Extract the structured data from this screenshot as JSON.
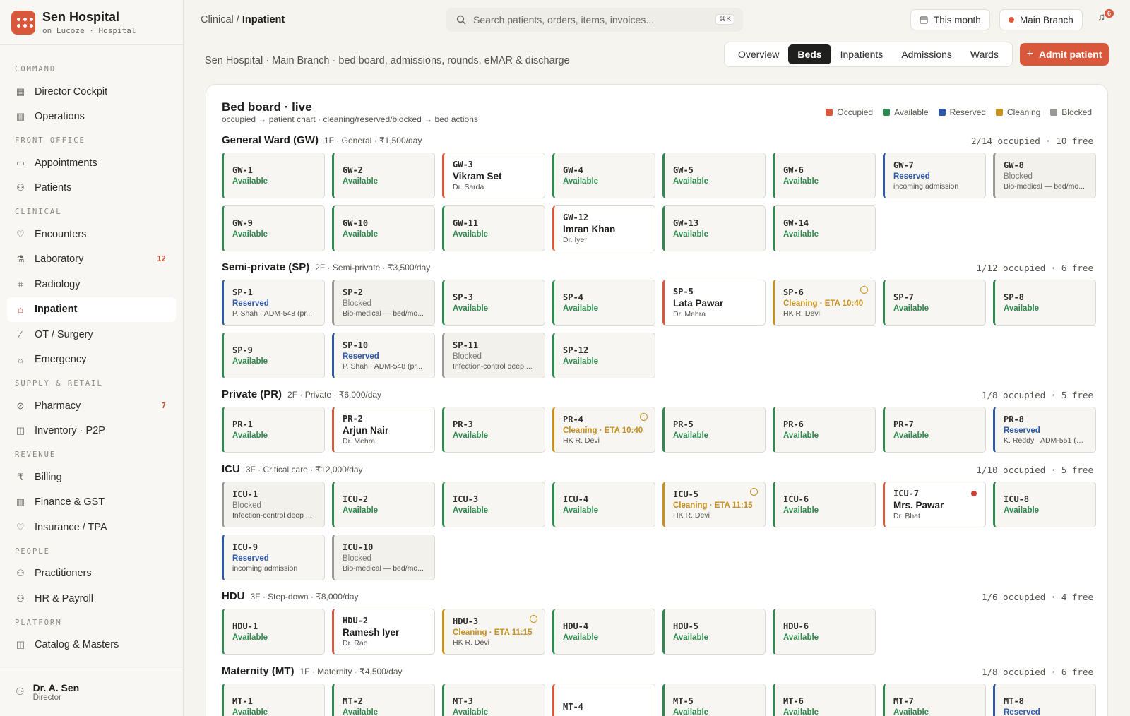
{
  "brand": {
    "name": "Sen Hospital",
    "sub": "on Lucoze · Hospital"
  },
  "nav": [
    {
      "type": "sec",
      "label": "COMMAND"
    },
    {
      "type": "item",
      "label": "Director Cockpit",
      "icon": "grid-icon"
    },
    {
      "type": "item",
      "label": "Operations",
      "icon": "bar-chart-icon"
    },
    {
      "type": "sec",
      "label": "FRONT OFFICE"
    },
    {
      "type": "item",
      "label": "Appointments",
      "icon": "calendar-icon"
    },
    {
      "type": "item",
      "label": "Patients",
      "icon": "users-icon"
    },
    {
      "type": "sec",
      "label": "CLINICAL"
    },
    {
      "type": "item",
      "label": "Encounters",
      "icon": "heart-icon"
    },
    {
      "type": "item",
      "label": "Laboratory",
      "icon": "flask-icon",
      "badge": "12"
    },
    {
      "type": "item",
      "label": "Radiology",
      "icon": "scan-icon"
    },
    {
      "type": "item",
      "label": "Inpatient",
      "icon": "bed-icon",
      "active": true
    },
    {
      "type": "item",
      "label": "OT / Surgery",
      "icon": "scalpel-icon"
    },
    {
      "type": "item",
      "label": "Emergency",
      "icon": "siren-icon"
    },
    {
      "type": "sec",
      "label": "SUPPLY & RETAIL"
    },
    {
      "type": "item",
      "label": "Pharmacy",
      "icon": "pill-icon",
      "badge": "7"
    },
    {
      "type": "item",
      "label": "Inventory · P2P",
      "icon": "box-icon"
    },
    {
      "type": "sec",
      "label": "REVENUE"
    },
    {
      "type": "item",
      "label": "Billing",
      "icon": "rupee-icon"
    },
    {
      "type": "item",
      "label": "Finance & GST",
      "icon": "bar-chart-icon"
    },
    {
      "type": "item",
      "label": "Insurance / TPA",
      "icon": "heart-icon"
    },
    {
      "type": "sec",
      "label": "PEOPLE"
    },
    {
      "type": "item",
      "label": "Practitioners",
      "icon": "users-icon"
    },
    {
      "type": "item",
      "label": "HR & Payroll",
      "icon": "users-icon"
    },
    {
      "type": "sec",
      "label": "PLATFORM"
    },
    {
      "type": "item",
      "label": "Catalog & Masters",
      "icon": "box-icon"
    }
  ],
  "user": {
    "name": "Dr. A. Sen",
    "role": "Director"
  },
  "topbar": {
    "crumb_parent": "Clinical /",
    "crumb_current": "Inpatient",
    "search_placeholder": "Search patients, orders, items, invoices...",
    "search_kbd": "⌘K",
    "period": "This month",
    "branch": "Main Branch",
    "notifications": "6"
  },
  "header": {
    "subtitle": "Sen Hospital · Main Branch · bed board, admissions, rounds, eMAR & discharge",
    "tabs": [
      "Overview",
      "Beds",
      "Inpatients",
      "Admissions",
      "Wards"
    ],
    "active_tab": "Beds",
    "admit_label": "Admit patient"
  },
  "board": {
    "title": "Bed board · live",
    "subtitle": "occupied → patient chart · cleaning/reserved/blocked → bed actions",
    "legend": [
      {
        "label": "Occupied",
        "color": "#d9573a"
      },
      {
        "label": "Available",
        "color": "#2e8a4e"
      },
      {
        "label": "Reserved",
        "color": "#2d58a8"
      },
      {
        "label": "Cleaning",
        "color": "#c8901c"
      },
      {
        "label": "Blocked",
        "color": "#9a9893"
      }
    ],
    "wards": [
      {
        "name": "General Ward (GW)",
        "meta": "1F · General · ₹1,500/day",
        "occupancy": "2/14 occupied · 10 free",
        "beds": [
          {
            "code": "GW-1",
            "state": "available",
            "status": "Available"
          },
          {
            "code": "GW-2",
            "state": "available",
            "status": "Available"
          },
          {
            "code": "GW-3",
            "state": "occupied",
            "status": "Vikram Set",
            "detail": "Dr. Sarda"
          },
          {
            "code": "GW-4",
            "state": "available",
            "status": "Available"
          },
          {
            "code": "GW-5",
            "state": "available",
            "status": "Available"
          },
          {
            "code": "GW-6",
            "state": "available",
            "status": "Available"
          },
          {
            "code": "GW-7",
            "state": "reserved",
            "status": "Reserved",
            "detail": "incoming admission"
          },
          {
            "code": "GW-8",
            "state": "blocked",
            "status": "Blocked",
            "detail": "Bio-medical — bed/mo..."
          },
          {
            "code": "GW-9",
            "state": "available",
            "status": "Available"
          },
          {
            "code": "GW-10",
            "state": "available",
            "status": "Available"
          },
          {
            "code": "GW-11",
            "state": "available",
            "status": "Available"
          },
          {
            "code": "GW-12",
            "state": "occupied",
            "status": "Imran Khan",
            "detail": "Dr. Iyer"
          },
          {
            "code": "GW-13",
            "state": "available",
            "status": "Available"
          },
          {
            "code": "GW-14",
            "state": "available",
            "status": "Available"
          }
        ]
      },
      {
        "name": "Semi-private (SP)",
        "meta": "2F · Semi-private · ₹3,500/day",
        "occupancy": "1/12 occupied · 6 free",
        "beds": [
          {
            "code": "SP-1",
            "state": "reserved",
            "status": "Reserved",
            "detail": "P. Shah · ADM-548 (pr..."
          },
          {
            "code": "SP-2",
            "state": "blocked",
            "status": "Blocked",
            "detail": "Bio-medical — bed/mo..."
          },
          {
            "code": "SP-3",
            "state": "available",
            "status": "Available"
          },
          {
            "code": "SP-4",
            "state": "available",
            "status": "Available"
          },
          {
            "code": "SP-5",
            "state": "occupied",
            "status": "Lata Pawar",
            "detail": "Dr. Mehra"
          },
          {
            "code": "SP-6",
            "state": "cleaning",
            "status": "Cleaning · ETA 10:40",
            "detail": "HK R. Devi",
            "icon": "clock-icon"
          },
          {
            "code": "SP-7",
            "state": "available",
            "status": "Available"
          },
          {
            "code": "SP-8",
            "state": "available",
            "status": "Available"
          },
          {
            "code": "SP-9",
            "state": "available",
            "status": "Available"
          },
          {
            "code": "SP-10",
            "state": "reserved",
            "status": "Reserved",
            "detail": "P. Shah · ADM-548 (pr..."
          },
          {
            "code": "SP-11",
            "state": "blocked",
            "status": "Blocked",
            "detail": "Infection-control deep ..."
          },
          {
            "code": "SP-12",
            "state": "available",
            "status": "Available"
          }
        ]
      },
      {
        "name": "Private (PR)",
        "meta": "2F · Private · ₹6,000/day",
        "occupancy": "1/8 occupied · 5 free",
        "beds": [
          {
            "code": "PR-1",
            "state": "available",
            "status": "Available"
          },
          {
            "code": "PR-2",
            "state": "occupied",
            "status": "Arjun Nair",
            "detail": "Dr. Mehra"
          },
          {
            "code": "PR-3",
            "state": "available",
            "status": "Available"
          },
          {
            "code": "PR-4",
            "state": "cleaning",
            "status": "Cleaning · ETA 10:40",
            "detail": "HK R. Devi",
            "icon": "clock-icon"
          },
          {
            "code": "PR-5",
            "state": "available",
            "status": "Available"
          },
          {
            "code": "PR-6",
            "state": "available",
            "status": "Available"
          },
          {
            "code": "PR-7",
            "state": "available",
            "status": "Available"
          },
          {
            "code": "PR-8",
            "state": "reserved",
            "status": "Reserved",
            "detail": "K. Reddy · ADM-551 (11..."
          }
        ]
      },
      {
        "name": "ICU",
        "meta": "3F · Critical care · ₹12,000/day",
        "occupancy": "1/10 occupied · 5 free",
        "beds": [
          {
            "code": "ICU-1",
            "state": "blocked",
            "status": "Blocked",
            "detail": "Infection-control deep ..."
          },
          {
            "code": "ICU-2",
            "state": "available",
            "status": "Available"
          },
          {
            "code": "ICU-3",
            "state": "available",
            "status": "Available"
          },
          {
            "code": "ICU-4",
            "state": "available",
            "status": "Available"
          },
          {
            "code": "ICU-5",
            "state": "cleaning",
            "status": "Cleaning · ETA 11:15",
            "detail": "HK R. Devi",
            "icon": "clock-icon"
          },
          {
            "code": "ICU-6",
            "state": "available",
            "status": "Available"
          },
          {
            "code": "ICU-7",
            "state": "occupied",
            "status": "Mrs. Pawar",
            "detail": "Dr. Bhat",
            "icon": "alert-dot-icon"
          },
          {
            "code": "ICU-8",
            "state": "available",
            "status": "Available"
          },
          {
            "code": "ICU-9",
            "state": "reserved",
            "status": "Reserved",
            "detail": "incoming admission"
          },
          {
            "code": "ICU-10",
            "state": "blocked",
            "status": "Blocked",
            "detail": "Bio-medical — bed/mo..."
          }
        ]
      },
      {
        "name": "HDU",
        "meta": "3F · Step-down · ₹8,000/day",
        "occupancy": "1/6 occupied · 4 free",
        "beds": [
          {
            "code": "HDU-1",
            "state": "available",
            "status": "Available"
          },
          {
            "code": "HDU-2",
            "state": "occupied",
            "status": "Ramesh Iyer",
            "detail": "Dr. Rao"
          },
          {
            "code": "HDU-3",
            "state": "cleaning",
            "status": "Cleaning · ETA 11:15",
            "detail": "HK R. Devi",
            "icon": "clock-icon"
          },
          {
            "code": "HDU-4",
            "state": "available",
            "status": "Available"
          },
          {
            "code": "HDU-5",
            "state": "available",
            "status": "Available"
          },
          {
            "code": "HDU-6",
            "state": "available",
            "status": "Available"
          }
        ]
      },
      {
        "name": "Maternity (MT)",
        "meta": "1F · Maternity · ₹4,500/day",
        "occupancy": "1/8 occupied · 6 free",
        "beds": [
          {
            "code": "MT-1",
            "state": "available",
            "status": "Available"
          },
          {
            "code": "MT-2",
            "state": "available",
            "status": "Available"
          },
          {
            "code": "MT-3",
            "state": "available",
            "status": "Available"
          },
          {
            "code": "MT-4",
            "state": "occupied",
            "status": "",
            "detail": ""
          },
          {
            "code": "MT-5",
            "state": "available",
            "status": "Available"
          },
          {
            "code": "MT-6",
            "state": "available",
            "status": "Available"
          },
          {
            "code": "MT-7",
            "state": "available",
            "status": "Available"
          },
          {
            "code": "MT-8",
            "state": "reserved",
            "status": "Reserved",
            "detail": ""
          }
        ]
      }
    ]
  }
}
